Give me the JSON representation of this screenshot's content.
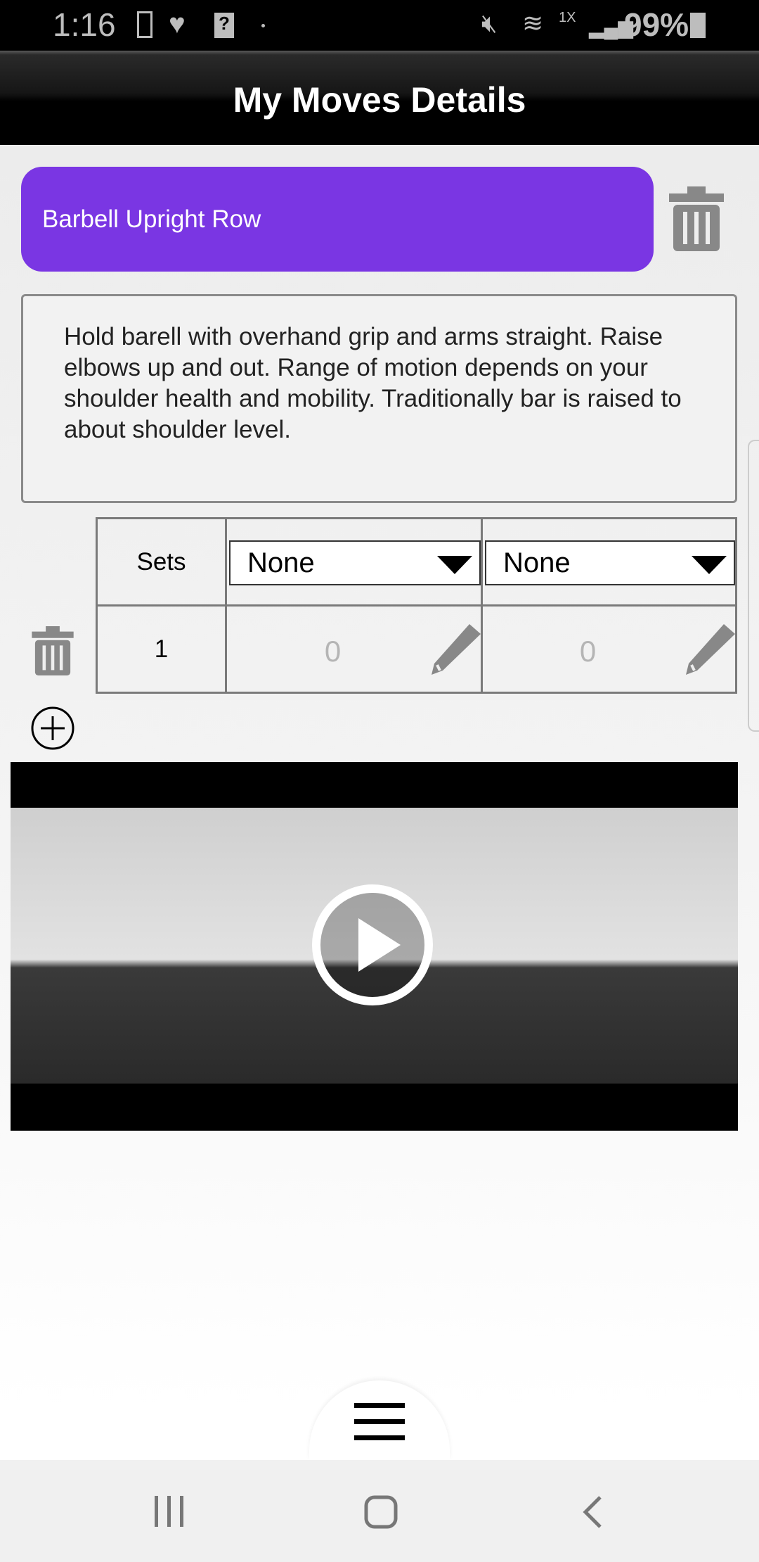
{
  "status_bar": {
    "time": "1:16",
    "battery": "99%",
    "network": "1X",
    "icons": [
      "device-icon",
      "heart-icon",
      "sim-question-icon",
      "mute-icon",
      "wifi-icon",
      "signal-icon",
      "battery-icon"
    ]
  },
  "header": {
    "title": "My Moves Details"
  },
  "move": {
    "name": "Barbell Upright Row",
    "color": "#7a36e3",
    "description": "Hold barell with overhand grip and arms straight. Raise elbows up and out. Range of motion depends on your shoulder health and mobility. Traditionally bar is raised to about shoulder level."
  },
  "table": {
    "header": {
      "sets": "Sets",
      "col1": "None",
      "col2": "None"
    },
    "rows": [
      {
        "set": "1",
        "val1": "0",
        "val2": "0"
      }
    ]
  },
  "video": {
    "icon": "play-icon"
  },
  "menu": {
    "icon": "hamburger-menu-icon"
  },
  "nav": {
    "icons": [
      "recents-icon",
      "home-icon",
      "back-icon"
    ]
  }
}
